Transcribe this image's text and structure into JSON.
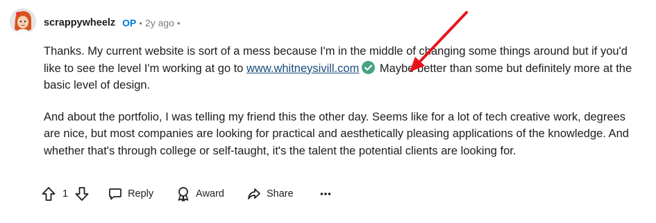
{
  "comment": {
    "author": "scrappywheelz",
    "op_badge": "OP",
    "separator": "•",
    "age": "2y ago",
    "trailing_separator": "•",
    "paragraph1": {
      "before_link": "Thanks. My current website is sort of a mess because I'm in the middle of changing some things around but if you'd like to see the level I'm working at go to ",
      "link_text": "www.whitneysivill.com",
      "after_link": " Maybe better than some but definitely more at the basic level of design."
    },
    "paragraph2": "And about the portfolio, I was telling my friend this the other day. Seems like for a lot of tech creative work, degrees are nice, but most companies are looking for practical and aesthetically pleasing applications of the knowledge. And whether that's through college or self-taught, it's the talent the potential clients are looking for."
  },
  "actions": {
    "upvote_icon": "arrow-up-icon",
    "vote_count": "1",
    "downvote_icon": "arrow-down-icon",
    "reply_label": "Reply",
    "reply_icon": "speech-bubble-icon",
    "award_label": "Award",
    "award_icon": "award-ribbon-icon",
    "share_label": "Share",
    "share_icon": "share-arrow-icon",
    "more_icon": "ellipsis-icon"
  },
  "colors": {
    "op": "#0079d3",
    "link": "#1a4b7e",
    "verified": "#46a285",
    "annotation_arrow": "#e8141b",
    "meta": "#787c7e"
  }
}
